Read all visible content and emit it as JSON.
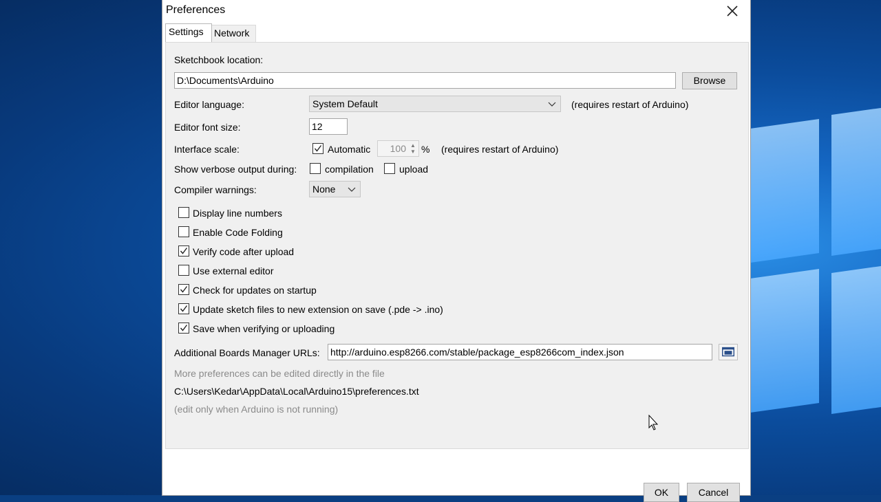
{
  "window": {
    "title": "Preferences"
  },
  "tabs": [
    {
      "label": "Settings",
      "active": true
    },
    {
      "label": "Network",
      "active": false
    }
  ],
  "settings": {
    "sketchbook_label": "Sketchbook location:",
    "sketchbook_value": "D:\\Documents\\Arduino",
    "browse_label": "Browse",
    "editor_language_label": "Editor language:",
    "editor_language_value": "System Default",
    "restart_note": "(requires restart of Arduino)",
    "font_size_label": "Editor font size:",
    "font_size_value": "12",
    "interface_scale_label": "Interface scale:",
    "automatic_label": "Automatic",
    "automatic_checked": true,
    "scale_value": "100",
    "percent": "%",
    "scale_note": "(requires restart of Arduino)",
    "verbose_label": "Show verbose output during:",
    "compilation_label": "compilation",
    "upload_label": "upload",
    "warnings_label": "Compiler warnings:",
    "warnings_value": "None",
    "options": [
      {
        "label": "Display line numbers",
        "checked": false
      },
      {
        "label": "Enable Code Folding",
        "checked": false
      },
      {
        "label": "Verify code after upload",
        "checked": true
      },
      {
        "label": "Use external editor",
        "checked": false
      },
      {
        "label": "Check for updates on startup",
        "checked": true
      },
      {
        "label": "Update sketch files to new extension on save (.pde -> .ino)",
        "checked": true
      },
      {
        "label": "Save when verifying or uploading",
        "checked": true
      }
    ],
    "boards_urls_label": "Additional Boards Manager URLs:",
    "boards_urls_value": "http://arduino.esp8266.com/stable/package_esp8266com_index.json",
    "more_prefs_note": "More preferences can be edited directly in the file",
    "prefs_path": "C:\\Users\\Kedar\\AppData\\Local\\Arduino15\\preferences.txt",
    "edit_note": "(edit only when Arduino is not running)"
  },
  "buttons": {
    "ok": "OK",
    "cancel": "Cancel"
  }
}
